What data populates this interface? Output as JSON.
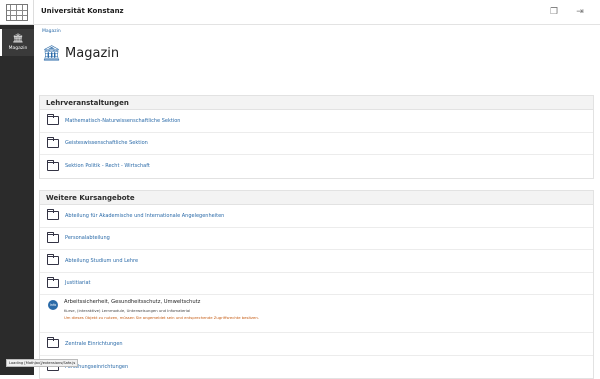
{
  "app": {
    "title": "Universität Konstanz"
  },
  "rail": {
    "magazin_label": "Magazin"
  },
  "breadcrumb": "Magazin",
  "page": {
    "title": "Magazin"
  },
  "lehrveranstaltungen": {
    "heading": "Lehrveranstaltungen",
    "items": [
      "Mathematisch-Naturwissenschaftliche Sektion",
      "Geisteswissenschaftliche Sektion",
      "Sektion Politik - Recht - Wirtschaft"
    ]
  },
  "weitere": {
    "heading": "Weitere Kursangebote",
    "items_before": [
      "Abteilung für Akademische und Internationale Angelegenheiten",
      "Personalabteilung",
      "Abteilung Studium und Lehre",
      "Justitiariat"
    ],
    "special": {
      "badge": "Info",
      "title": "Arbeitssicherheit, Gesundheitsschutz, Umweltschutz",
      "description": "Kurse, (interaktive) Lernmodule, Unterweisungen und Infomaterial",
      "warning": "Um dieses Objekt zu nutzen, müssen Sie angemeldet sein und entsprechende Zugriffsrechte besitzen."
    },
    "items_after": [
      "Zentrale Einrichtungen",
      "Forschungseinrichtungen"
    ]
  },
  "status_text": "Loading [MathJax]/extensions/Safe.js",
  "icons": {
    "logo": "university-logo-icon",
    "magazin": "institution-icon",
    "topbar_left": "window-stack-icon",
    "topbar_right": "logout-icon",
    "folder": "folder-icon"
  },
  "colors": {
    "accent": "#2a6aa8",
    "rail": "#2b2b2b",
    "warning": "#c55a11"
  }
}
